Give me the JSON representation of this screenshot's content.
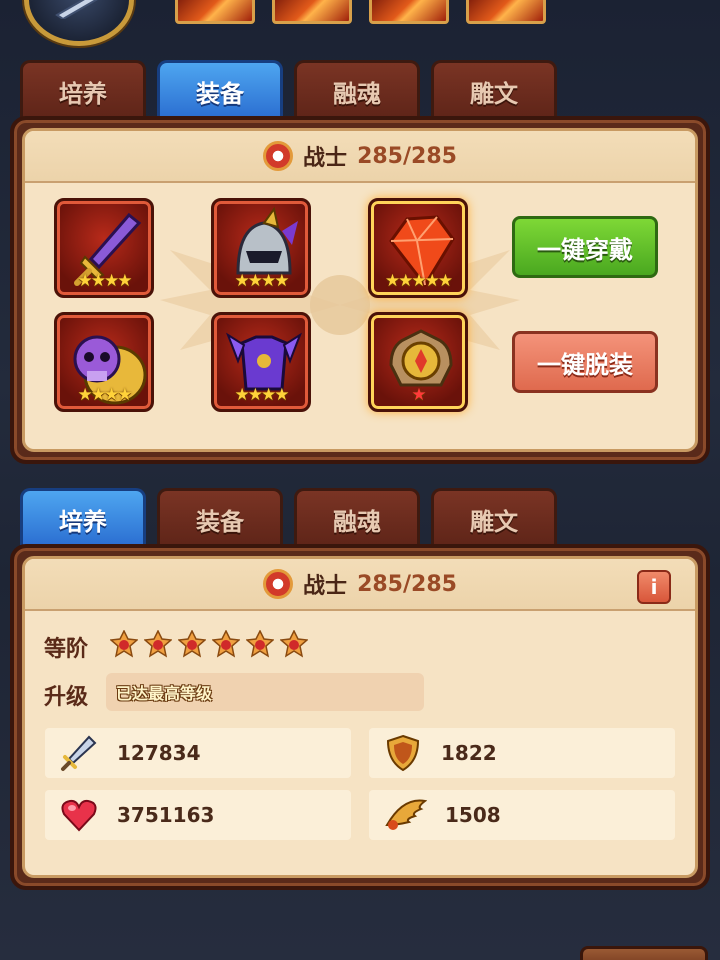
{
  "top": {
    "avatar_icon": "hero-portrait-icon",
    "skills": [
      "skill-icon-1",
      "skill-icon-2",
      "skill-icon-3",
      "skill-icon-4"
    ]
  },
  "equipment_view": {
    "tabs": [
      {
        "label": "培养",
        "active": false
      },
      {
        "label": "装备",
        "active": true
      },
      {
        "label": "融魂",
        "active": false
      },
      {
        "label": "雕文",
        "active": false
      }
    ],
    "class_name": "战士",
    "class_count": "285/285",
    "slots": [
      {
        "icon": "sword-icon",
        "stars": "★★★★"
      },
      {
        "icon": "helmet-icon",
        "stars": "★★★★"
      },
      {
        "icon": "ruby-gem-icon",
        "stars": "★★★★★"
      },
      {
        "icon": "skull-shield-icon",
        "stars": "★★★★"
      },
      {
        "icon": "chest-armor-icon",
        "stars": "★★★★"
      },
      {
        "icon": "medal-emblem-icon",
        "stars": "★"
      }
    ],
    "equip_all_label": "一键穿戴",
    "unequip_all_label": "一键脱装"
  },
  "stats_view": {
    "tabs": [
      {
        "label": "培养",
        "active": true
      },
      {
        "label": "装备",
        "active": false
      },
      {
        "label": "融魂",
        "active": false
      },
      {
        "label": "雕文",
        "active": false
      }
    ],
    "class_name": "战士",
    "class_count": "285/285",
    "info_icon": "info-icon",
    "rank_label": "等阶",
    "rank_stars": 6,
    "upgrade_label": "升级",
    "upgrade_status": "已达最高等级",
    "stats": [
      {
        "icon": "attack-sword-icon",
        "value": "127834"
      },
      {
        "icon": "defense-shield-icon",
        "value": "1822"
      },
      {
        "icon": "health-heart-icon",
        "value": "3751163"
      },
      {
        "icon": "speed-wing-icon",
        "value": "1508"
      }
    ]
  },
  "colors": {
    "active_tab": "#2a6cd0",
    "inactive_tab": "#5e2418",
    "panel_bg": "#f6e3c4",
    "equip_button": "#4aa820",
    "unequip_button": "#df6a4e"
  }
}
